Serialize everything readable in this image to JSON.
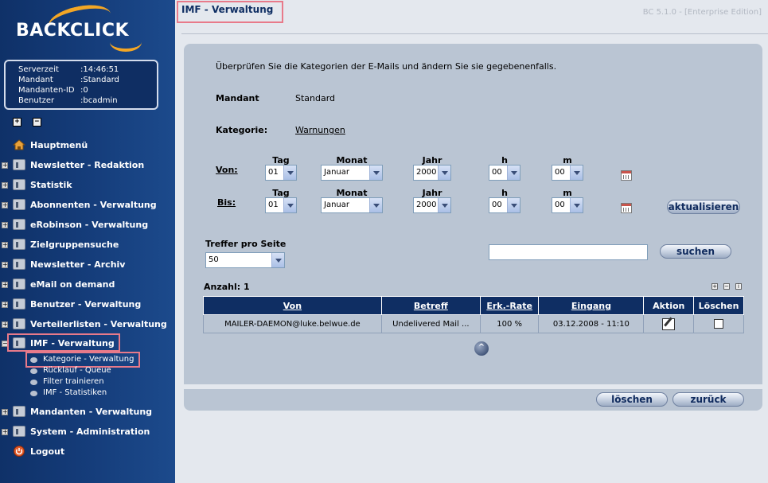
{
  "logo": {
    "text": "BACKCLICK"
  },
  "info": [
    {
      "key": "Serverzeit",
      "value": "14:46:51"
    },
    {
      "key": "Mandant",
      "value": "Standard"
    },
    {
      "key": "Mandanten-ID",
      "value": "0"
    },
    {
      "key": "Benutzer",
      "value": "bcadmin"
    }
  ],
  "nav": [
    {
      "label": "Hauptmenü",
      "icon": "home-icon"
    },
    {
      "label": "Newsletter - Redaktion",
      "icon": "folder-icon"
    },
    {
      "label": "Statistik",
      "icon": "folder-icon"
    },
    {
      "label": "Abonnenten - Verwaltung",
      "icon": "folder-icon"
    },
    {
      "label": "eRobinson - Verwaltung",
      "icon": "folder-icon"
    },
    {
      "label": "Zielgruppensuche",
      "icon": "folder-icon"
    },
    {
      "label": "Newsletter - Archiv",
      "icon": "folder-icon"
    },
    {
      "label": "eMail on demand",
      "icon": "folder-icon"
    },
    {
      "label": "Benutzer - Verwaltung",
      "icon": "folder-icon"
    },
    {
      "label": "Verteilerlisten - Verwaltung",
      "icon": "folder-icon"
    },
    {
      "label": "IMF - Verwaltung",
      "icon": "folder-open-icon"
    },
    {
      "label": "Mandanten - Verwaltung",
      "icon": "folder-icon"
    },
    {
      "label": "System - Administration",
      "icon": "folder-icon"
    },
    {
      "label": "Logout",
      "icon": "logout-icon"
    }
  ],
  "subnav": [
    {
      "label": "Kategorie - Verwaltung"
    },
    {
      "label": "Rücklauf - Queue"
    },
    {
      "label": "Filter trainieren"
    },
    {
      "label": "IMF - Statistiken"
    }
  ],
  "header": {
    "title": "IMF - Verwaltung",
    "version": "BC 5.1.0 - [Enterprise Edition]"
  },
  "form": {
    "intro": "Überprüfen Sie die Kategorien der E-Mails und ändern Sie sie gegebenenfalls.",
    "mandant_label": "Mandant",
    "mandant_value": "Standard",
    "kategorie_label": "Kategorie:",
    "kategorie_value": "Warnungen",
    "von_label": "Von:",
    "bis_label": "Bis:",
    "col_tag": "Tag",
    "col_monat": "Monat",
    "col_jahr": "Jahr",
    "col_h": "h",
    "col_m": "m",
    "von": {
      "tag": "01",
      "monat": "Januar",
      "jahr": "2000",
      "h": "00",
      "m": "00"
    },
    "bis": {
      "tag": "01",
      "monat": "Januar",
      "jahr": "2000",
      "h": "00",
      "m": "00"
    },
    "refresh_label": "aktualisieren",
    "per_page_label": "Treffer pro Seite",
    "per_page_value": "50",
    "search_label": "suchen",
    "search_value": "",
    "count_label": "Anzahl: 1"
  },
  "table": {
    "headers": [
      "Von",
      "Betreff",
      "Erk.-Rate",
      "Eingang",
      "Aktion",
      "Löschen"
    ],
    "rows": [
      {
        "von": "MAILER-DAEMON@luke.belwue.de",
        "betreff": "Undelivered Mail ...",
        "rate": "100 %",
        "eingang": "03.12.2008 - 11:10"
      }
    ]
  },
  "footer": {
    "delete_label": "löschen",
    "back_label": "zurück"
  }
}
